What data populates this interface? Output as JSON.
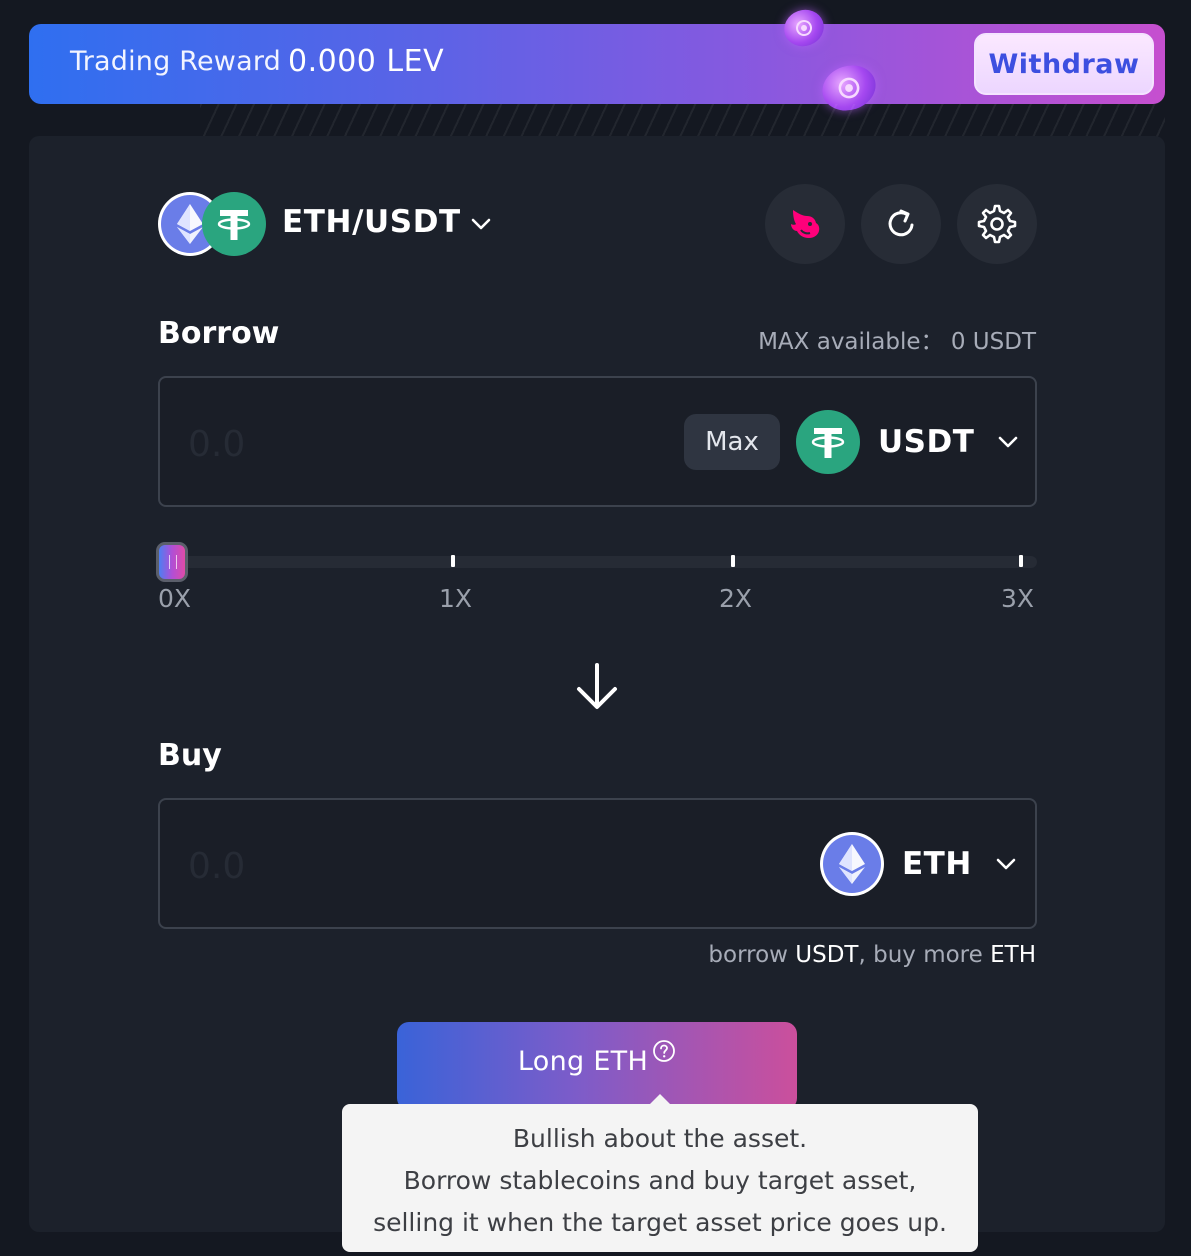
{
  "banner": {
    "label": "Trading Reward",
    "value": "0.000 LEV",
    "withdraw_label": "Withdraw"
  },
  "pair": {
    "label": "ETH/USDT",
    "base_icon": "eth-icon",
    "quote_icon": "usdt-icon"
  },
  "toolbar": {
    "icons": [
      "uniswap-icon",
      "refresh-icon",
      "settings-icon"
    ]
  },
  "borrow": {
    "title": "Borrow",
    "max_available_label": "MAX available：",
    "max_available_value": "0 USDT",
    "amount_placeholder": "0.0",
    "max_label": "Max",
    "token": "USDT"
  },
  "leverage": {
    "ticks": [
      "0X",
      "1X",
      "2X",
      "3X"
    ],
    "value": 0
  },
  "buy": {
    "title": "Buy",
    "amount_placeholder": "0.0",
    "token": "ETH"
  },
  "hint": {
    "part1": "borrow ",
    "token1": "USDT",
    "part2": ", buy more ",
    "token2": "ETH"
  },
  "action": {
    "label": "Long ETH"
  },
  "tooltip": {
    "line1": "Bullish about the asset.",
    "line2": "Borrow stablecoins and buy target asset,",
    "line3": "selling it when the target asset price goes up."
  },
  "colors": {
    "background": "#141821",
    "card": "#1c212b",
    "eth": "#6a7de8",
    "usdt": "#2aa57f",
    "withdraw_text": "#3d4fe0",
    "uniswap": "#ff007a"
  }
}
